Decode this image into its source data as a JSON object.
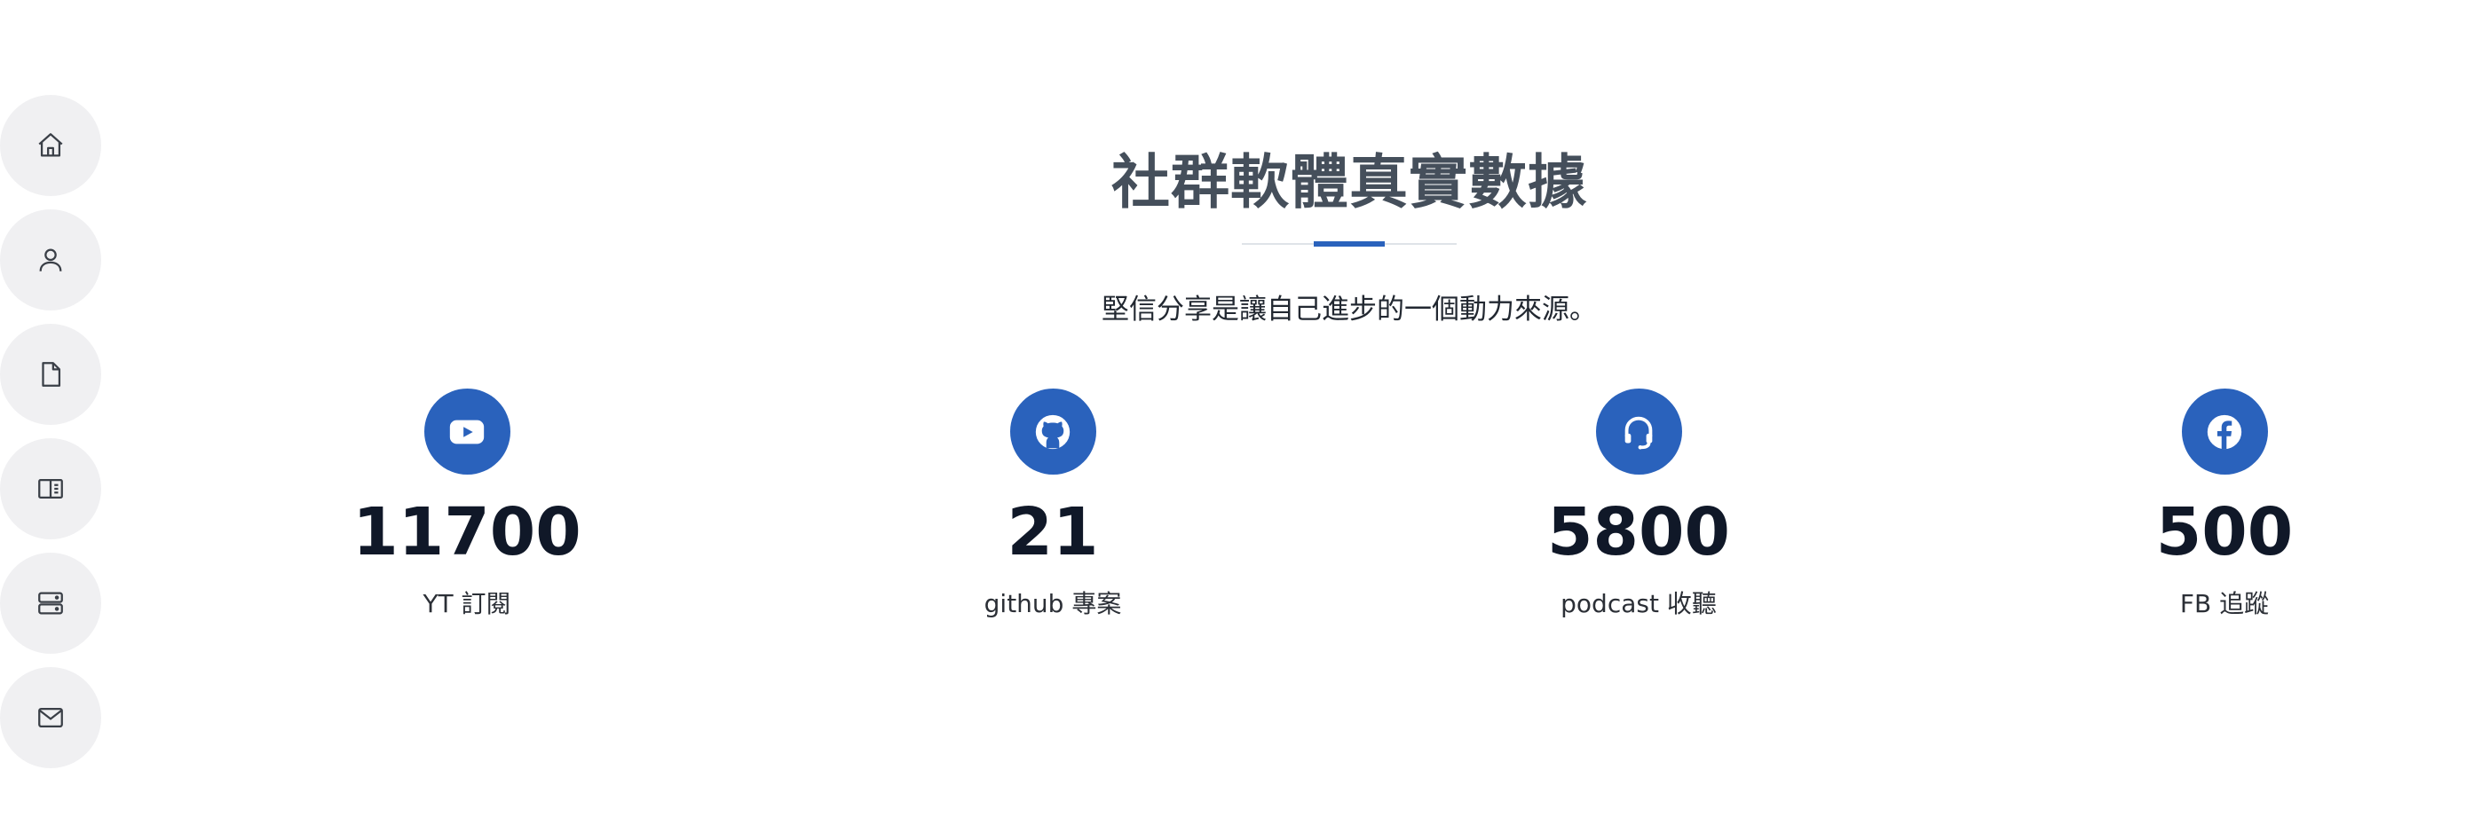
{
  "sidebar": {
    "items": [
      {
        "icon": "home-icon"
      },
      {
        "icon": "user-icon"
      },
      {
        "icon": "file-icon"
      },
      {
        "icon": "book-icon"
      },
      {
        "icon": "server-icon"
      },
      {
        "icon": "mail-icon"
      }
    ]
  },
  "section": {
    "title": "社群軟體真實數據",
    "subtitle": "堅信分享是讓自己進步的一個動力來源。"
  },
  "stats": [
    {
      "icon": "youtube-icon",
      "value": "11700",
      "label": "YT 訂閱"
    },
    {
      "icon": "github-icon",
      "value": "21",
      "label": "github 專案"
    },
    {
      "icon": "headset-icon",
      "value": "5800",
      "label": "podcast 收聽"
    },
    {
      "icon": "facebook-icon",
      "value": "500",
      "label": "FB 追蹤"
    }
  ],
  "colors": {
    "accent": "#2a62bc",
    "title": "#454f5b",
    "nav_bg": "#f0f0f2"
  }
}
